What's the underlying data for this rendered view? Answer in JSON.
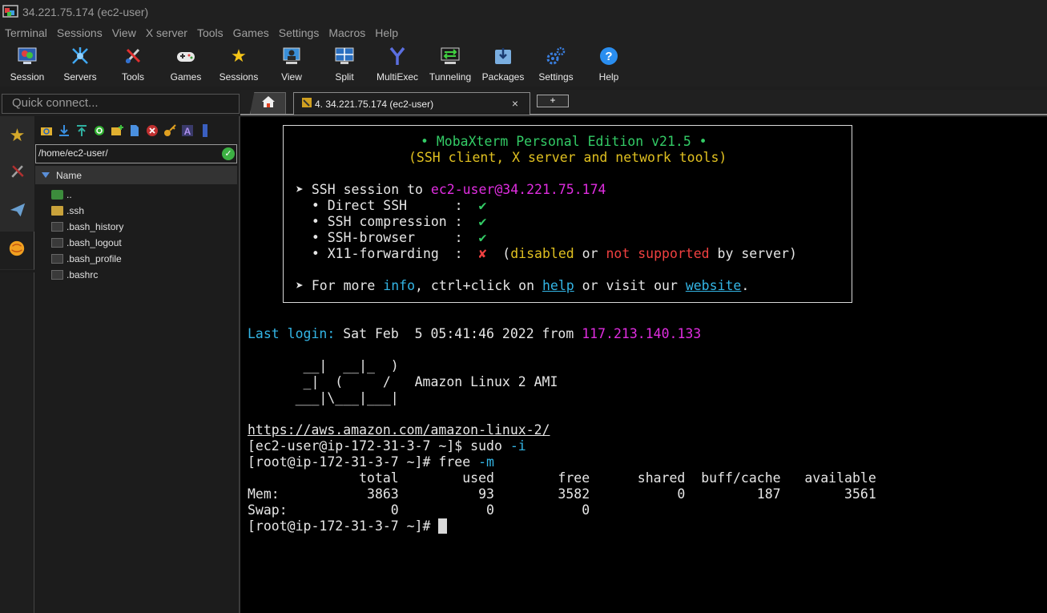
{
  "window": {
    "title": "34.221.75.174 (ec2-user)"
  },
  "menu": [
    "Terminal",
    "Sessions",
    "View",
    "X server",
    "Tools",
    "Games",
    "Settings",
    "Macros",
    "Help"
  ],
  "toolbar": [
    {
      "label": "Session",
      "icon": "session-icon"
    },
    {
      "label": "Servers",
      "icon": "servers-icon"
    },
    {
      "label": "Tools",
      "icon": "tools-icon"
    },
    {
      "label": "Games",
      "icon": "gamepad-icon"
    },
    {
      "label": "Sessions",
      "icon": "star-icon"
    },
    {
      "label": "View",
      "icon": "view-icon"
    },
    {
      "label": "Split",
      "icon": "split-icon"
    },
    {
      "label": "MultiExec",
      "icon": "multiexec-icon"
    },
    {
      "label": "Tunneling",
      "icon": "tunneling-icon"
    },
    {
      "label": "Packages",
      "icon": "packages-icon"
    },
    {
      "label": "Settings",
      "icon": "gears-icon"
    },
    {
      "label": "Help",
      "icon": "help-icon"
    }
  ],
  "quick_connect": {
    "placeholder": "Quick connect..."
  },
  "sftp": {
    "path": "/home/ec2-user/",
    "column_header": "Name",
    "files": [
      {
        "name": "..",
        "type": "up"
      },
      {
        "name": ".ssh",
        "type": "folder"
      },
      {
        "name": ".bash_history",
        "type": "file"
      },
      {
        "name": ".bash_logout",
        "type": "file"
      },
      {
        "name": ".bash_profile",
        "type": "file"
      },
      {
        "name": ".bashrc",
        "type": "file"
      }
    ]
  },
  "tabs": {
    "session_tab": "4. 34.221.75.174 (ec2-user)",
    "close": "×",
    "new_tab": "+"
  },
  "terminal": {
    "banner_title": "• MobaXterm Personal Edition v21.5 •",
    "banner_subtitle": "(SSH client, X server and network tools)",
    "ssh_session_prefix": "➤ SSH session to ",
    "ssh_target": "ec2-user@34.221.75.174",
    "direct_ssh": "  • Direct SSH      :  ",
    "ssh_compression": "  • SSH compression :  ",
    "ssh_browser": "  • SSH-browser     :  ",
    "x11_forwarding": "  • X11-forwarding  :  ",
    "check": "✔",
    "cross": "✘",
    "x11_open": "  (",
    "x11_disabled": "disabled",
    "x11_or": " or ",
    "x11_not_supported": "not supported",
    "x11_by_server": " by server)",
    "more_prefix": "➤ For more ",
    "more_info": "info",
    "more_mid": ", ctrl+click on ",
    "more_help": "help",
    "more_mid2": " or visit our ",
    "more_website": "website",
    "more_end": ".",
    "last_login_label": "Last login:",
    "last_login_value": " Sat Feb  5 05:41:46 2022 from ",
    "last_login_ip": "117.213.140.133",
    "ascii_1": "       __|  __|_  )",
    "ascii_2": "       _|  (     /   Amazon Linux 2 AMI",
    "ascii_3": "      ___|\\___|___|",
    "aws_url": "https://aws.amazon.com/amazon-linux-2/",
    "prompt1": "[ec2-user@ip-172-31-3-7 ~]$ sudo ",
    "prompt1_flag": "-i",
    "prompt2": "[root@ip-172-31-3-7 ~]# free ",
    "prompt2_flag": "-m",
    "free_header": "              total        used        free      shared  buff/cache   available",
    "free_mem": "Mem:           3863          93        3582           0         187        3561",
    "free_swap": "Swap:             0           0           0",
    "prompt3": "[root@ip-172-31-3-7 ~]# "
  },
  "colors": {
    "accent_green": "#33cc66",
    "accent_yellow": "#e0c020",
    "accent_magenta": "#e02de0",
    "accent_cyan": "#33b5e5",
    "accent_red": "#f04040"
  }
}
